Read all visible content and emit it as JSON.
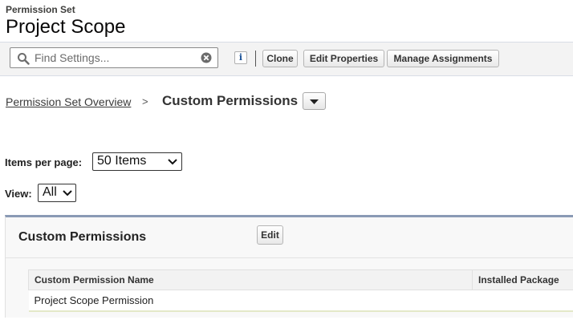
{
  "header": {
    "subtitle": "Permission Set",
    "title": "Project Scope"
  },
  "toolbar": {
    "search_placeholder": "Find Settings...",
    "info_label": "i",
    "buttons": {
      "clone": "Clone",
      "edit_properties": "Edit Properties",
      "manage_assignments": "Manage Assignments"
    }
  },
  "breadcrumb": {
    "link": "Permission Set Overview",
    "separator": ">",
    "current": "Custom Permissions"
  },
  "controls": {
    "items_per_page_label": "Items per page:",
    "items_per_page_value": "50 Items",
    "view_label": "View:",
    "view_value": "All"
  },
  "panel": {
    "title": "Custom Permissions",
    "edit_label": "Edit",
    "table": {
      "headers": [
        "Custom Permission Name",
        "Installed Package"
      ],
      "rows": [
        [
          "Project Scope Permission",
          ""
        ]
      ]
    }
  },
  "icons": {
    "search": "search-icon",
    "clear": "clear-icon",
    "dropdown": "chevron-down-icon"
  },
  "colors": {
    "panel_accent": "#8a9ab5",
    "toolbar_bg": "#f3f3f3",
    "info_blue": "#1b5297"
  }
}
